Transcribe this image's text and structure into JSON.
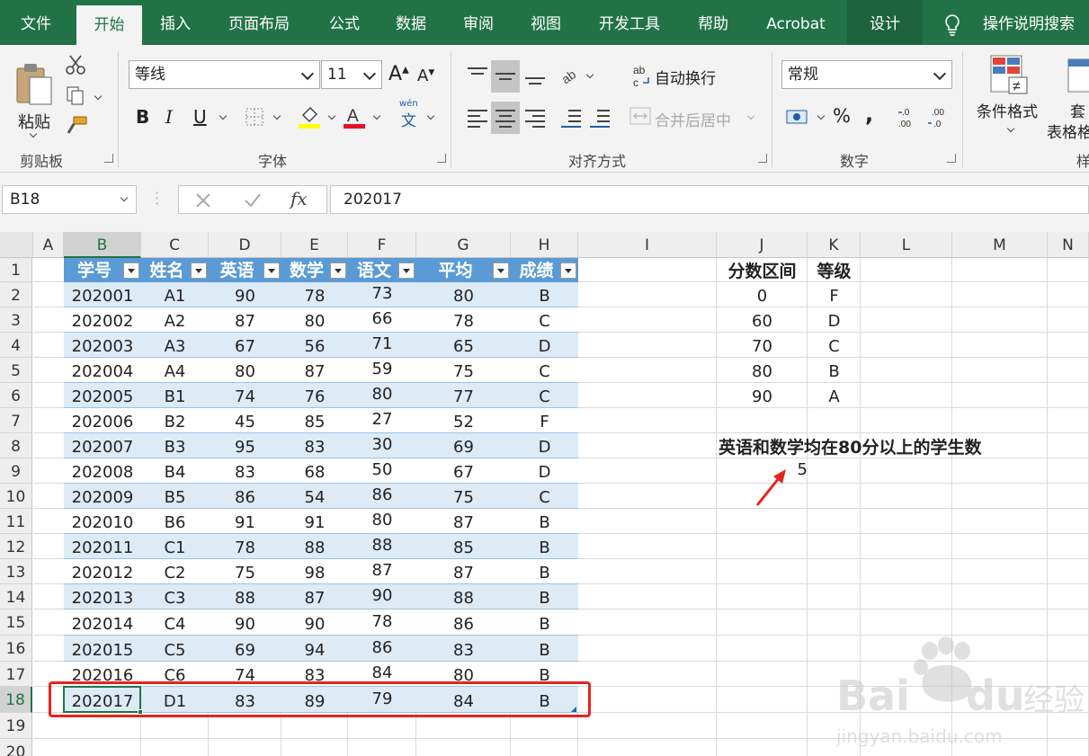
{
  "ribbon_tabs": [
    "文件",
    "开始",
    "插入",
    "页面布局",
    "公式",
    "数据",
    "审阅",
    "视图",
    "开发工具",
    "帮助",
    "Acrobat",
    "设计"
  ],
  "tell_me": "操作说明搜索",
  "clipboard": {
    "paste": "粘贴",
    "group": "剪贴板"
  },
  "font": {
    "name": "等线",
    "size": "11",
    "bold": "B",
    "italic": "I",
    "underline": "U",
    "phonetic": "wén",
    "phonetic_char": "文",
    "group": "字体"
  },
  "alignment": {
    "wrap_text": "自动换行",
    "merge_center": "合并后居中",
    "group": "对齐方式"
  },
  "number": {
    "format": "常规",
    "percent": "%",
    "comma": ",",
    "group": "数字"
  },
  "styles": {
    "conditional": "条件格式",
    "table_a": "套",
    "table_b": "表格格",
    "group_partial": "样"
  },
  "formula_bar": {
    "name_box": "B18",
    "fx": "fx",
    "value": "202017"
  },
  "columns": [
    "A",
    "B",
    "C",
    "D",
    "E",
    "F",
    "G",
    "H",
    "I",
    "J",
    "K",
    "L",
    "M",
    "N"
  ],
  "rows": [
    "1",
    "2",
    "3",
    "4",
    "5",
    "6",
    "7",
    "8",
    "9",
    "10",
    "11",
    "12",
    "13",
    "14",
    "15",
    "16",
    "17",
    "18",
    "19",
    "20"
  ],
  "table_headers": [
    "学号",
    "姓名",
    "英语",
    "数学",
    "语文",
    "平均",
    "成绩"
  ],
  "table_rows": [
    [
      "202001",
      "A1",
      "90",
      "78",
      "73",
      "80",
      "B"
    ],
    [
      "202002",
      "A2",
      "87",
      "80",
      "66",
      "78",
      "C"
    ],
    [
      "202003",
      "A3",
      "67",
      "56",
      "71",
      "65",
      "D"
    ],
    [
      "202004",
      "A4",
      "80",
      "87",
      "59",
      "75",
      "C"
    ],
    [
      "202005",
      "B1",
      "74",
      "76",
      "80",
      "77",
      "C"
    ],
    [
      "202006",
      "B2",
      "45",
      "85",
      "27",
      "52",
      "F"
    ],
    [
      "202007",
      "B3",
      "95",
      "83",
      "30",
      "69",
      "D"
    ],
    [
      "202008",
      "B4",
      "83",
      "68",
      "50",
      "67",
      "D"
    ],
    [
      "202009",
      "B5",
      "86",
      "54",
      "86",
      "75",
      "C"
    ],
    [
      "202010",
      "B6",
      "91",
      "91",
      "80",
      "87",
      "B"
    ],
    [
      "202011",
      "C1",
      "78",
      "88",
      "88",
      "85",
      "B"
    ],
    [
      "202012",
      "C2",
      "75",
      "98",
      "87",
      "87",
      "B"
    ],
    [
      "202013",
      "C3",
      "88",
      "87",
      "90",
      "88",
      "B"
    ],
    [
      "202014",
      "C4",
      "90",
      "90",
      "78",
      "86",
      "B"
    ],
    [
      "202015",
      "C5",
      "69",
      "94",
      "86",
      "83",
      "B"
    ],
    [
      "202016",
      "C6",
      "74",
      "83",
      "84",
      "80",
      "B"
    ],
    [
      "202017",
      "D1",
      "83",
      "89",
      "79",
      "84",
      "B"
    ]
  ],
  "grade_table": {
    "headers": [
      "分数区间",
      "等级"
    ],
    "rows": [
      [
        "0",
        "F"
      ],
      [
        "60",
        "D"
      ],
      [
        "70",
        "C"
      ],
      [
        "80",
        "B"
      ],
      [
        "90",
        "A"
      ]
    ]
  },
  "summary": {
    "label": "英语和数学均在80分以上的学生数",
    "value": "5"
  },
  "watermark": {
    "brand": "Baidu经验",
    "url": "jingyan.baidu.com"
  },
  "colors": {
    "excel_green": "#217346",
    "table_header": "#5b9bd5",
    "band": "#ddebf7",
    "highlight_box": "#e8231c"
  }
}
